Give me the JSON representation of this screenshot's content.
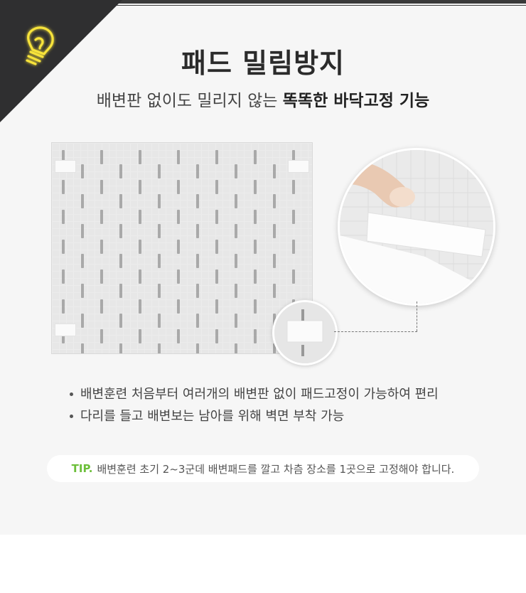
{
  "header": {
    "title": "패드 밀림방지",
    "subtitle_plain": "배변판 없이도 밀리지 않는",
    "subtitle_bold": "똑똑한 바닥고정 기능",
    "icon": "lightbulb-icon"
  },
  "features": [
    "배변훈련 처음부터 여러개의 배변판 없이 패드고정이 가능하여 편리",
    "다리를 들고 배변보는 남아를 위해 벽면 부착 가능"
  ],
  "tip": {
    "label": "TIP.",
    "text": "배변훈련 초기 2~3군데 배변패드를 깔고  차츰 장소를 1곳으로 고정해야 합니다."
  },
  "colors": {
    "accent": "#6cbf3a",
    "neon": "#f7e33a",
    "corner": "#2f2f30"
  }
}
